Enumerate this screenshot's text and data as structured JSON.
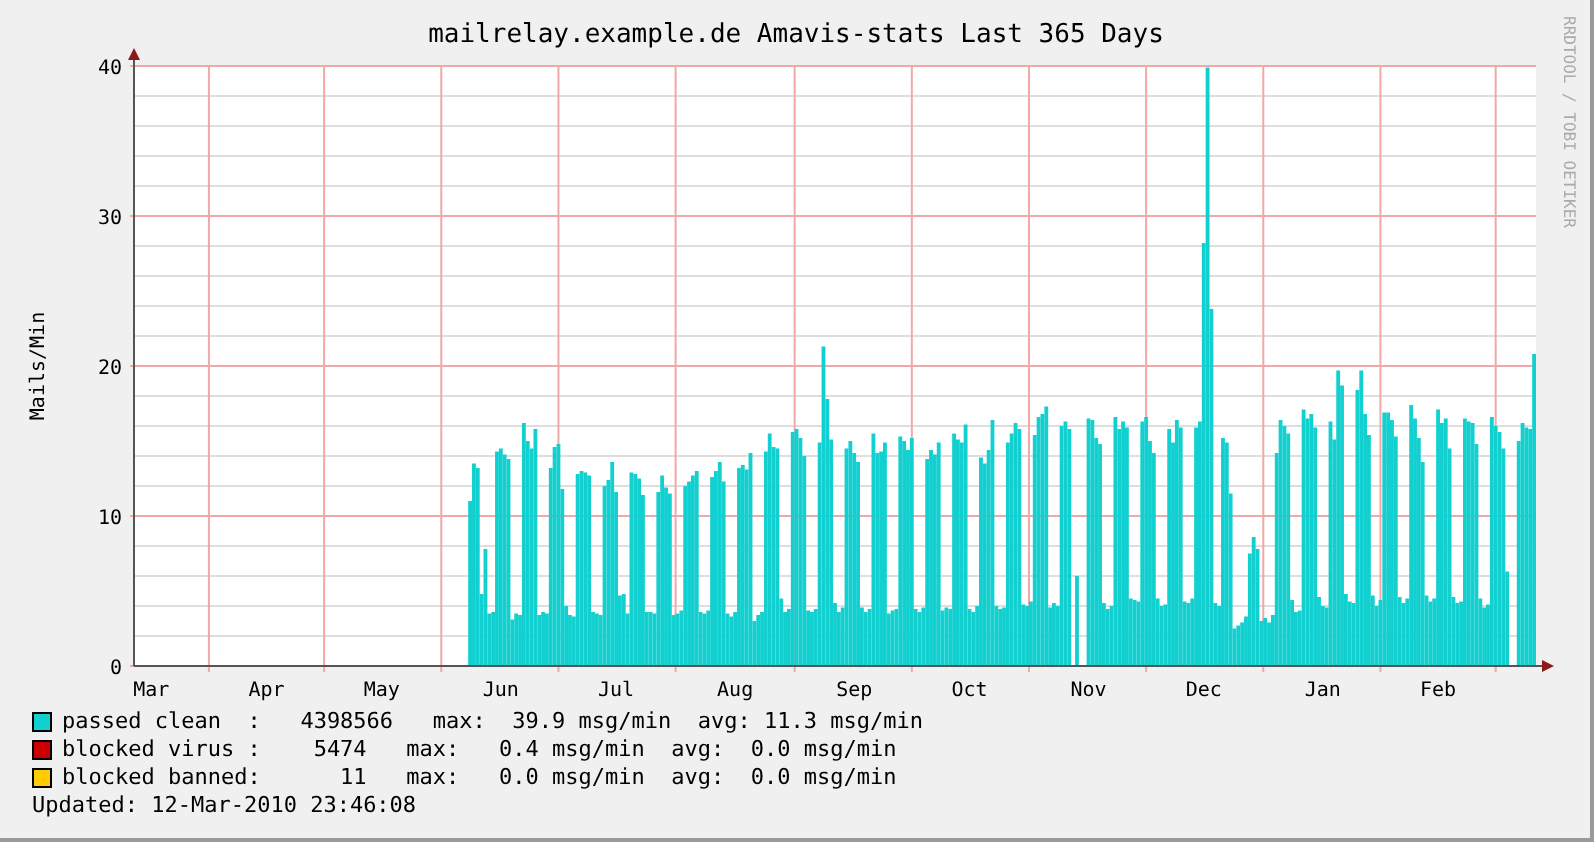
{
  "chart": {
    "credit": "RRDTOOL / TOBI OETIKER",
    "chart_data": {
      "type": "bar",
      "grid": true,
      "title": "mailrelay.example.de Amavis-stats Last 365 Days",
      "ylabel": "Mails/Min",
      "ylim": [
        0,
        40
      ],
      "yticks": [
        0,
        10,
        20,
        30,
        40
      ],
      "categories": [
        null,
        null,
        null,
        null,
        "Mar",
        null,
        null,
        null,
        null,
        null,
        null,
        null,
        null,
        null,
        null,
        null,
        null,
        null,
        null,
        null,
        null,
        null,
        null,
        null,
        null,
        null,
        null,
        null,
        null,
        null,
        null,
        null,
        null,
        null,
        "Apr",
        null,
        null,
        null,
        null,
        null,
        null,
        null,
        null,
        null,
        null,
        null,
        null,
        null,
        null,
        null,
        null,
        null,
        null,
        null,
        null,
        null,
        null,
        null,
        null,
        null,
        null,
        null,
        null,
        null,
        "May",
        null,
        null,
        null,
        null,
        null,
        null,
        null,
        null,
        null,
        null,
        null,
        null,
        null,
        null,
        null,
        null,
        null,
        null,
        null,
        null,
        null,
        null,
        null,
        null,
        null,
        null,
        null,
        null,
        null,
        null,
        "Jun",
        null,
        null,
        null,
        null,
        null,
        null,
        null,
        null,
        null,
        null,
        null,
        null,
        null,
        null,
        null,
        null,
        null,
        null,
        null,
        null,
        null,
        null,
        null,
        null,
        null,
        null,
        null,
        null,
        null,
        "Jul",
        null,
        null,
        null,
        null,
        null,
        null,
        null,
        null,
        null,
        null,
        null,
        null,
        null,
        null,
        null,
        null,
        null,
        null,
        null,
        null,
        null,
        null,
        null,
        null,
        null,
        null,
        null,
        null,
        null,
        null,
        "Aug",
        null,
        null,
        null,
        null,
        null,
        null,
        null,
        null,
        null,
        null,
        null,
        null,
        null,
        null,
        null,
        null,
        null,
        null,
        null,
        null,
        null,
        null,
        null,
        null,
        null,
        null,
        null,
        null,
        null,
        null,
        "Sep",
        null,
        null,
        null,
        null,
        null,
        null,
        null,
        null,
        null,
        null,
        null,
        null,
        null,
        null,
        null,
        null,
        null,
        null,
        null,
        null,
        null,
        null,
        null,
        null,
        null,
        null,
        null,
        null,
        null,
        "Oct",
        null,
        null,
        null,
        null,
        null,
        null,
        null,
        null,
        null,
        null,
        null,
        null,
        null,
        null,
        null,
        null,
        null,
        null,
        null,
        null,
        null,
        null,
        null,
        null,
        null,
        null,
        null,
        null,
        null,
        null,
        "Nov",
        null,
        null,
        null,
        null,
        null,
        null,
        null,
        null,
        null,
        null,
        null,
        null,
        null,
        null,
        null,
        null,
        null,
        null,
        null,
        null,
        null,
        null,
        null,
        null,
        null,
        null,
        null,
        null,
        null,
        "Dec",
        null,
        null,
        null,
        null,
        null,
        null,
        null,
        null,
        null,
        null,
        null,
        null,
        null,
        null,
        null,
        null,
        null,
        null,
        null,
        null,
        null,
        null,
        null,
        null,
        null,
        null,
        null,
        null,
        null,
        null,
        "Jan",
        null,
        null,
        null,
        null,
        null,
        null,
        null,
        null,
        null,
        null,
        null,
        null,
        null,
        null,
        null,
        null,
        null,
        null,
        null,
        null,
        null,
        null,
        null,
        null,
        null,
        null,
        null,
        null,
        null,
        "Feb",
        null,
        null,
        null,
        null,
        null,
        null,
        null,
        null,
        null,
        null,
        null,
        null,
        null,
        null,
        null,
        null,
        null,
        null,
        null,
        null,
        null,
        null,
        null,
        null,
        null
      ],
      "series": [
        {
          "color": "#12d0d0",
          "values": [
            null,
            null,
            null,
            null,
            null,
            null,
            null,
            null,
            null,
            null,
            null,
            null,
            null,
            null,
            null,
            null,
            null,
            null,
            null,
            null,
            null,
            null,
            null,
            null,
            null,
            null,
            null,
            null,
            null,
            null,
            null,
            null,
            null,
            null,
            null,
            null,
            null,
            null,
            null,
            null,
            null,
            null,
            null,
            null,
            null,
            null,
            null,
            null,
            null,
            null,
            null,
            null,
            null,
            null,
            null,
            null,
            null,
            null,
            null,
            null,
            null,
            null,
            null,
            null,
            null,
            null,
            null,
            null,
            null,
            null,
            null,
            null,
            null,
            null,
            null,
            null,
            null,
            null,
            null,
            null,
            null,
            null,
            null,
            null,
            null,
            null,
            null,
            11,
            13.5,
            13.2,
            4.8,
            7.8,
            3.5,
            3.6,
            14.3,
            14.5,
            14.1,
            13.8,
            3.1,
            3.5,
            3.4,
            16.2,
            15,
            14.5,
            15.8,
            3.4,
            3.6,
            3.5,
            13.2,
            14.6,
            14.8,
            11.8,
            4,
            3.4,
            3.3,
            12.8,
            13,
            12.9,
            12.7,
            3.6,
            3.5,
            3.4,
            12,
            12.4,
            13.6,
            11.6,
            4.7,
            4.8,
            3.5,
            12.9,
            12.8,
            12.5,
            11.4,
            3.6,
            3.6,
            3.5,
            11.6,
            12.7,
            11.9,
            11.5,
            3.4,
            3.5,
            3.7,
            12,
            12.3,
            12.7,
            13,
            3.6,
            3.5,
            3.7,
            12.6,
            13,
            13.6,
            12.3,
            3.5,
            3.3,
            3.6,
            13.2,
            13.4,
            13.1,
            14.2,
            3,
            3.4,
            3.6,
            14.3,
            15.5,
            14.6,
            14.5,
            4.5,
            3.6,
            3.8,
            15.6,
            15.8,
            15.2,
            14,
            3.7,
            3.6,
            3.8,
            14.9,
            21.3,
            17.8,
            15.1,
            4.2,
            3.6,
            3.9,
            14.5,
            15,
            14.2,
            13.6,
            3.9,
            3.6,
            3.8,
            15.5,
            14.2,
            14.3,
            14.9,
            3.5,
            3.7,
            3.8,
            15.3,
            15,
            14.4,
            15.2,
            3.8,
            3.6,
            3.9,
            13.8,
            14.4,
            14.1,
            14.9,
            3.7,
            3.9,
            3.8,
            15.5,
            15.1,
            14.9,
            16.1,
            3.8,
            3.6,
            4,
            13.9,
            13.5,
            14.4,
            16.4,
            4,
            3.8,
            3.9,
            14.9,
            15.5,
            16.2,
            15.8,
            4.1,
            4,
            4.3,
            15.4,
            16.6,
            16.8,
            17.3,
            3.9,
            4.2,
            4,
            16,
            16.3,
            15.8,
            0,
            6,
            0,
            0,
            16.5,
            16.4,
            15.2,
            14.8,
            4.2,
            3.8,
            4,
            16.6,
            15.8,
            16.3,
            15.9,
            4.5,
            4.4,
            4.3,
            16.3,
            16.6,
            15,
            14.2,
            4.5,
            4,
            4.1,
            15.8,
            14.9,
            16.4,
            15.9,
            4.3,
            4.2,
            4.5,
            15.9,
            16.3,
            28.2,
            39.9,
            23.8,
            4.2,
            4,
            15.2,
            14.9,
            11.5,
            2.5,
            2.7,
            2.9,
            3.3,
            7.5,
            8.6,
            7.8,
            3,
            3.2,
            2.9,
            3.4,
            14.2,
            16.4,
            16,
            15.5,
            4.4,
            3.6,
            3.7,
            17.1,
            16.5,
            16.8,
            15.9,
            4.6,
            4,
            3.9,
            16.3,
            15.1,
            19.7,
            18.7,
            4.8,
            4.3,
            4.2,
            18.4,
            19.7,
            16.8,
            15.4,
            4.7,
            4,
            4.4,
            16.9,
            16.9,
            16.4,
            15.3,
            4.6,
            4.2,
            4.5,
            17.4,
            16.5,
            15.2,
            13.6,
            4.7,
            4.3,
            4.5,
            17.1,
            16.2,
            16.5,
            14.5,
            4.6,
            4.2,
            4.3,
            16.5,
            16.3,
            16.2,
            14.8,
            4.5,
            3.9,
            4.1,
            16.6,
            16,
            15.6,
            14.5,
            6.3,
            0,
            0,
            15,
            16.2,
            15.9,
            15.8,
            20.8
          ]
        }
      ]
    }
  },
  "legend": [
    {
      "name": "passed clean",
      "color": "#12d0d0",
      "stats": ":   4398566   max:  39.9 msg/min  avg: 11.3 msg/min"
    },
    {
      "name": "blocked virus",
      "color": "#cc0000",
      "stats": ":    5474   max:   0.4 msg/min  avg:  0.0 msg/min"
    },
    {
      "name": "blocked banned",
      "color": "#ffcc00",
      "stats": ":      11   max:   0.0 msg/min  avg:  0.0 msg/min"
    }
  ],
  "updated": "Updated: 12-Mar-2010 23:46:08"
}
